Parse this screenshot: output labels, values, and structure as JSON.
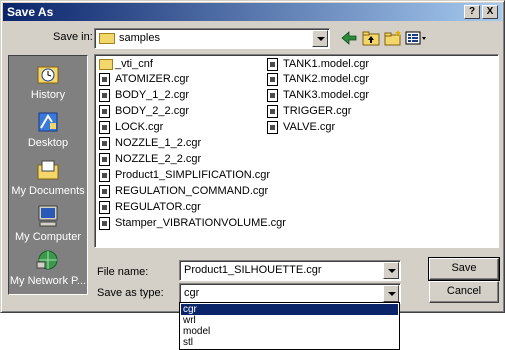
{
  "window": {
    "title": "Save As"
  },
  "title_buttons": {
    "help": "?",
    "close": "X"
  },
  "toolbar": {
    "save_in_label": "Save in:",
    "save_in_value": "samples",
    "icons": [
      "back-arrow-icon",
      "up-folder-icon",
      "new-folder-icon",
      "views-menu-icon"
    ]
  },
  "places": [
    {
      "label": "History",
      "icon": "history-icon"
    },
    {
      "label": "Desktop",
      "icon": "desktop-icon"
    },
    {
      "label": "My Documents",
      "icon": "my-documents-icon"
    },
    {
      "label": "My Computer",
      "icon": "my-computer-icon"
    },
    {
      "label": "My Network P...",
      "icon": "my-network-icon"
    }
  ],
  "files": {
    "column1": [
      {
        "name": "_vti_cnf",
        "type": "folder"
      },
      {
        "name": "ATOMIZER.cgr",
        "type": "file"
      },
      {
        "name": "BODY_1_2.cgr",
        "type": "file"
      },
      {
        "name": "BODY_2_2.cgr",
        "type": "file"
      },
      {
        "name": "LOCK.cgr",
        "type": "file"
      },
      {
        "name": "NOZZLE_1_2.cgr",
        "type": "file"
      },
      {
        "name": "NOZZLE_2_2.cgr",
        "type": "file"
      },
      {
        "name": "Product1_SIMPLIFICATION.cgr",
        "type": "file"
      },
      {
        "name": "REGULATION_COMMAND.cgr",
        "type": "file"
      },
      {
        "name": "REGULATOR.cgr",
        "type": "file"
      },
      {
        "name": "Stamper_VIBRATIONVOLUME.cgr",
        "type": "file"
      }
    ],
    "column2": [
      {
        "name": "TANK1.model.cgr",
        "type": "file"
      },
      {
        "name": "TANK2.model.cgr",
        "type": "file"
      },
      {
        "name": "TANK3.model.cgr",
        "type": "file"
      },
      {
        "name": "TRIGGER.cgr",
        "type": "file"
      },
      {
        "name": "VALVE.cgr",
        "type": "file"
      }
    ]
  },
  "form": {
    "filename_label": "File name:",
    "filename_value": "Product1_SILHOUETTE.cgr",
    "savetype_label": "Save as type:",
    "savetype_value": "cgr"
  },
  "buttons": {
    "save": "Save",
    "cancel": "Cancel"
  },
  "type_options": [
    {
      "label": "cgr",
      "selected": true
    },
    {
      "label": "wrl",
      "selected": false
    },
    {
      "label": "model",
      "selected": false
    },
    {
      "label": "stl",
      "selected": false
    }
  ]
}
